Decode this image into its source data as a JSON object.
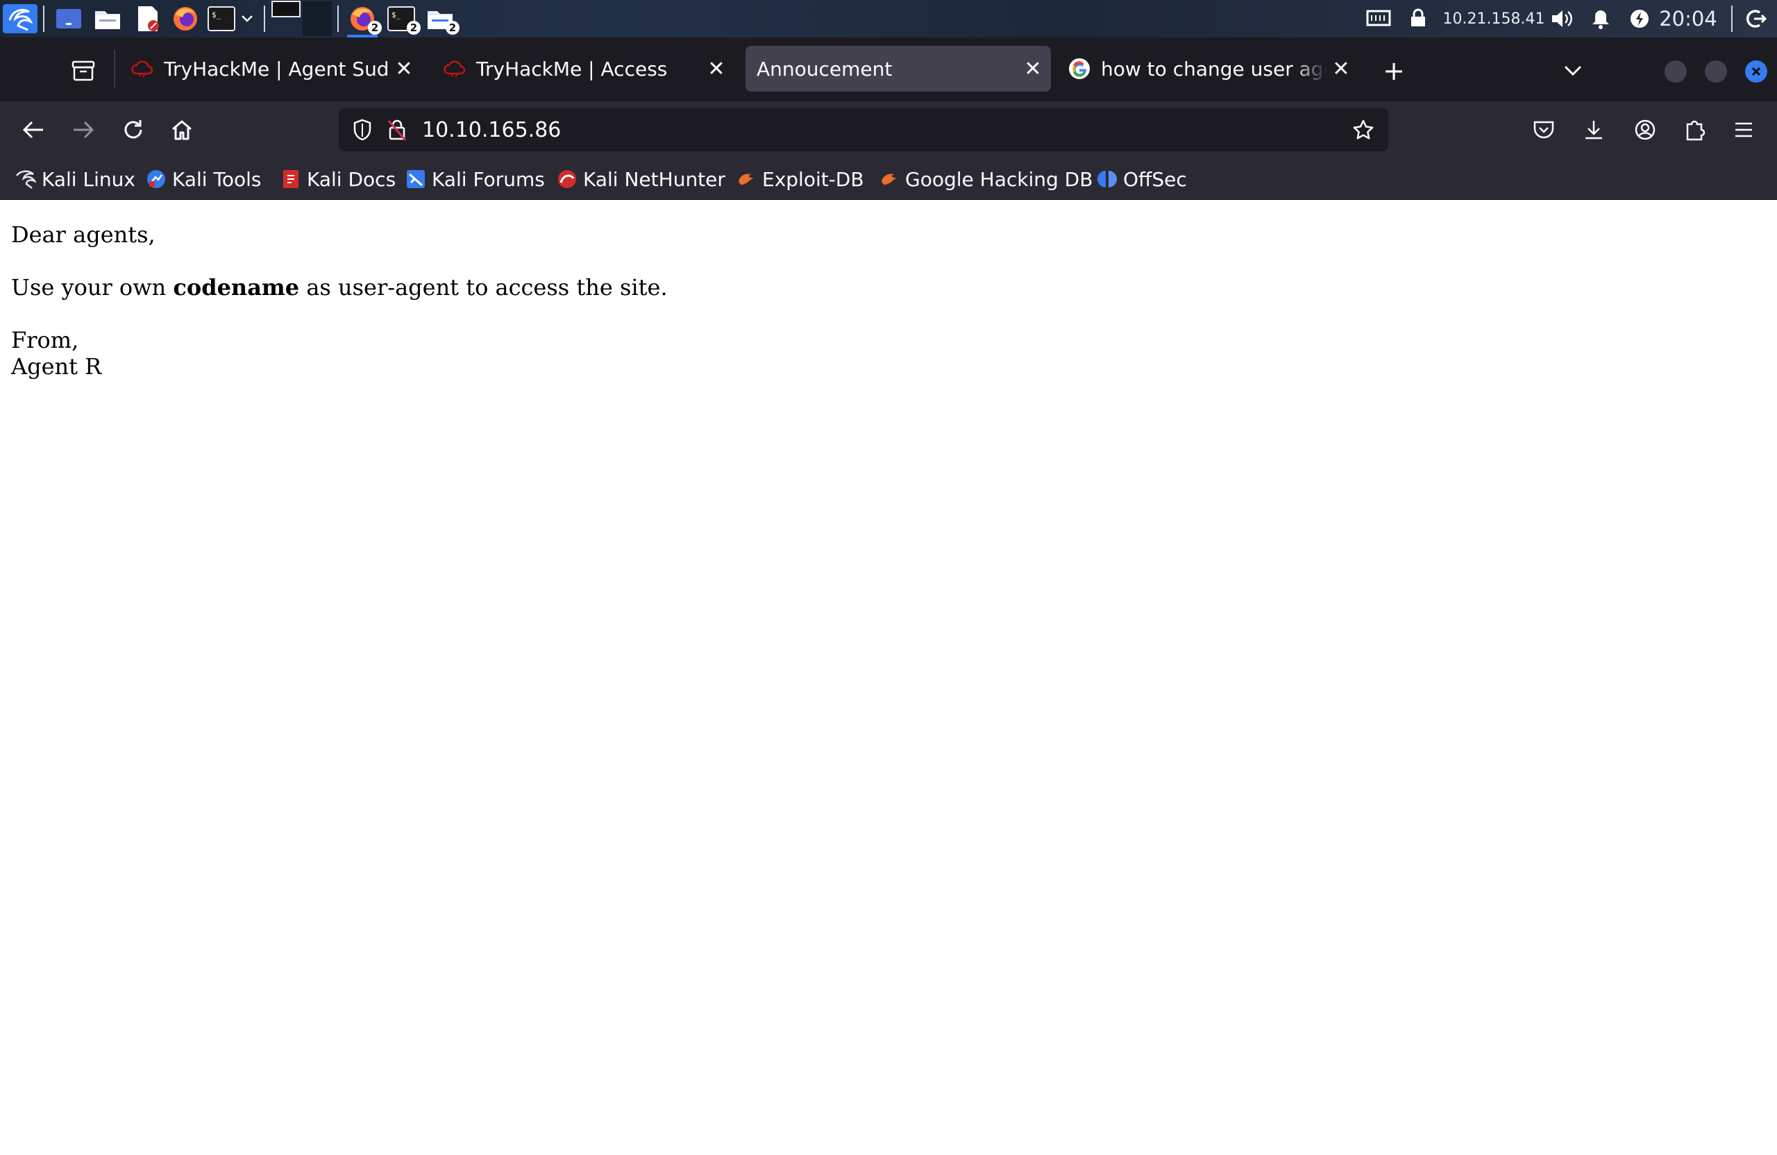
{
  "panel": {
    "badges": {
      "firefox": "2",
      "terminal": "2",
      "files": "2"
    },
    "tray": {
      "ip": "10.21.158.41",
      "time": "20:04"
    },
    "icons": [
      "kali-menu-icon",
      "workspace-icon",
      "files-icon",
      "text-editor-icon",
      "firefox-icon",
      "terminal-icon",
      "dropdown-chevron-icon"
    ]
  },
  "browser": {
    "tabs": [
      {
        "title": "TryHackMe | Agent Sudo",
        "favicon": "tryhackme-icon",
        "active": false
      },
      {
        "title": "TryHackMe | Access",
        "favicon": "tryhackme-icon",
        "active": false
      },
      {
        "title": "Annoucement",
        "favicon": "",
        "active": true
      },
      {
        "title": "how to change user agent",
        "favicon": "google-icon",
        "active": false
      }
    ],
    "url": "10.10.165.86",
    "bookmarks": [
      {
        "label": "Kali Linux",
        "icon": "kali-dragon-icon"
      },
      {
        "label": "Kali Tools",
        "icon": "kali-tools-icon"
      },
      {
        "label": "Kali Docs",
        "icon": "kali-docs-icon"
      },
      {
        "label": "Kali Forums",
        "icon": "kali-forums-icon"
      },
      {
        "label": "Kali NetHunter",
        "icon": "nethunter-icon"
      },
      {
        "label": "Exploit-DB",
        "icon": "exploit-db-icon"
      },
      {
        "label": "Google Hacking DB",
        "icon": "ghdb-icon"
      },
      {
        "label": "OffSec",
        "icon": "offsec-icon"
      }
    ]
  },
  "page": {
    "greeting": "Dear agents,",
    "line_prefix": "Use your own ",
    "line_bold": "codename",
    "line_suffix": " as user-agent to access the site.",
    "signoff_from": "From,",
    "signoff_name": "Agent R"
  },
  "colors": {
    "panel_bg": "#1b2636",
    "tabstrip_bg": "#1c1b22",
    "toolbar_bg": "#2b2a33",
    "active_tab_bg": "#42414d",
    "kali_blue": "#367bf0",
    "tryhackme_red": "#c11111"
  }
}
